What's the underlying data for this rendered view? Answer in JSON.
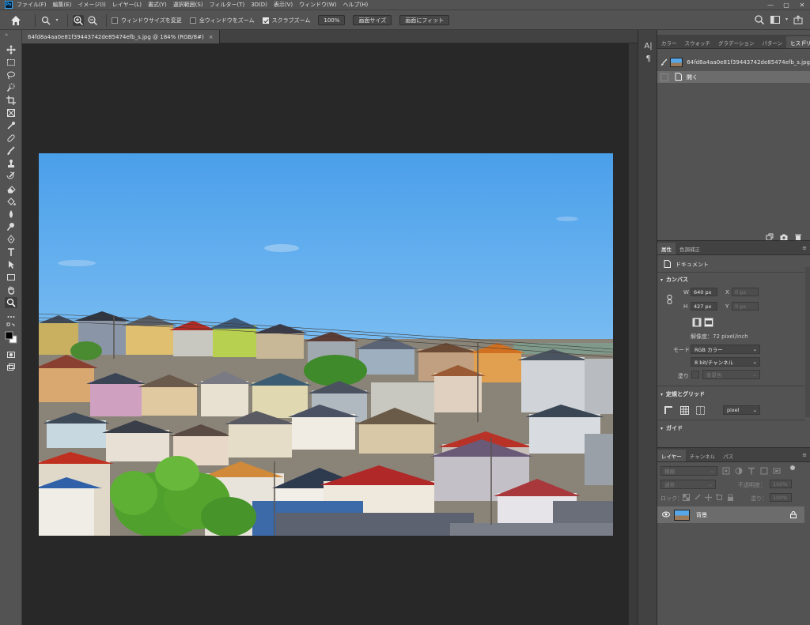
{
  "menu": {
    "logo": "Ps",
    "items": [
      "ファイル(F)",
      "編集(E)",
      "イメージ(I)",
      "レイヤー(L)",
      "書式(Y)",
      "選択範囲(S)",
      "フィルター(T)",
      "3D(D)",
      "表示(V)",
      "ウィンドウ(W)",
      "ヘルプ(H)"
    ]
  },
  "options": {
    "resize_windows": "ウィンドウサイズを変更",
    "zoom_all": "全ウィンドウをズーム",
    "scrubby_zoom": "スクラブズーム",
    "zoom_value": "100%",
    "fit_size_button": "画面サイズ",
    "fit_screen_button": "画面にフィット"
  },
  "document": {
    "tab_title": "64fd8a4aa0e81f39443742de85474efb_s.jpg @ 184% (RGB/8#)",
    "close": "×"
  },
  "history": {
    "tabs": [
      "カラー",
      "スウォッチ",
      "グラデーション",
      "パターン",
      "ヒストリー"
    ],
    "active_tab": "ヒストリー",
    "snapshot_name": "64fd8a4aa0e81f39443742de85474efb_s.jpg",
    "state": "開く"
  },
  "properties": {
    "tabs": [
      "属性",
      "色調補正"
    ],
    "doc_label": "ドキュメント",
    "canvas_heading": "カンバス",
    "w_label": "W",
    "w_value": "640 px",
    "h_label": "H",
    "h_value": "427 px",
    "x_label": "X",
    "x_value": "0 px",
    "y_label": "Y",
    "y_value": "0 px",
    "resolution": "解像度：72 pixel/inch",
    "mode_label": "モード",
    "mode_value": "RGB カラー",
    "depth_value": "8 bit/チャンネル",
    "fill_label": "塗り",
    "fill_value": "背景色",
    "rulers_heading": "定規とグリッド",
    "unit_value": "pixel",
    "guides_heading": "ガイド"
  },
  "layers": {
    "tabs": [
      "レイヤー",
      "チャンネル",
      "パス"
    ],
    "search_placeholder": "種類",
    "blend_mode": "通常",
    "opacity_label": "不透明度：",
    "opacity_value": "100%",
    "lock_label": "ロック：",
    "fill_label": "塗り：",
    "fill_value": "100%",
    "layer_name": "背景"
  },
  "colors": {
    "app_bg": "#535353",
    "canvas_bg": "#282828",
    "sky": "#58a8ec",
    "selected_row": "#6c6c6c"
  }
}
